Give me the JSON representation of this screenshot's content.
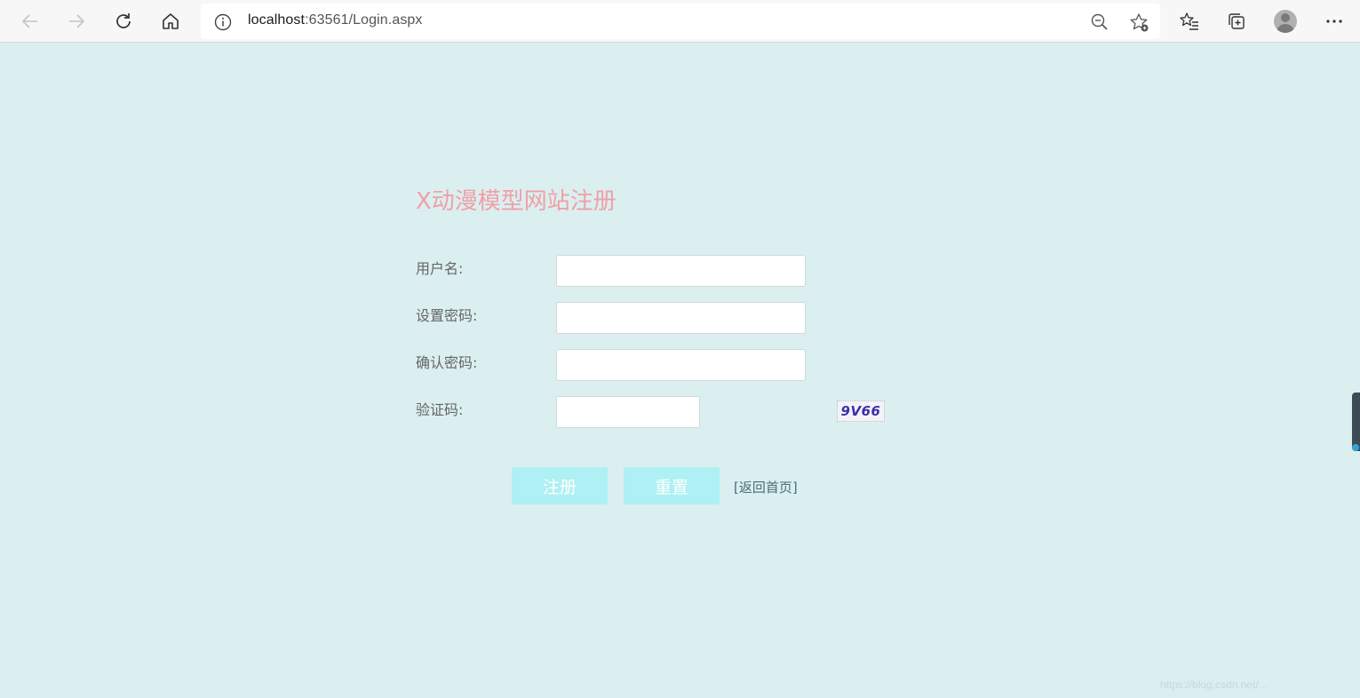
{
  "browser": {
    "url_host": "localhost",
    "url_rest": ":63561/Login.aspx",
    "icons": [
      "back-icon",
      "forward-icon",
      "refresh-icon",
      "home-icon",
      "info-icon",
      "zoom-out-icon",
      "favorite-add-icon",
      "favorites-icon",
      "collections-icon",
      "profile-icon",
      "more-icon"
    ]
  },
  "page": {
    "title": "X动漫模型网站注册",
    "fields": {
      "username_label": "用户名:",
      "password_label": "设置密码:",
      "confirm_label": "确认密码:",
      "captcha_label": "验证码:"
    },
    "captcha_text": "9V66",
    "register_button": "注册",
    "reset_button": "重置",
    "back_link": "[返回首页]"
  },
  "watermark": "https://blog.csdn.net/...",
  "colors": {
    "background": "#dbeff0",
    "title": "#f0a0a8",
    "button": "#aef0f4"
  }
}
